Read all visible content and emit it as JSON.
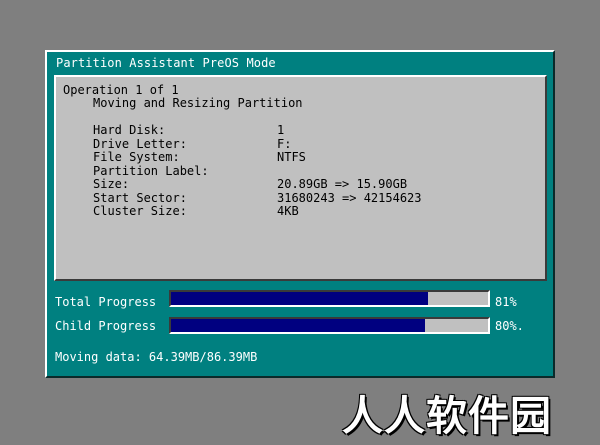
{
  "window": {
    "title": "Partition Assistant PreOS Mode"
  },
  "operation": {
    "header": "Operation 1 of 1",
    "task": "Moving and Resizing Partition",
    "details": [
      {
        "label": "Hard Disk:",
        "value": "1"
      },
      {
        "label": "Drive Letter:",
        "value": "F:"
      },
      {
        "label": "File System:",
        "value": "NTFS"
      },
      {
        "label": "Partition Label:",
        "value": ""
      },
      {
        "label": "Size:",
        "value": "20.89GB => 15.90GB"
      },
      {
        "label": "Start Sector:",
        "value": "31680243 => 42154623"
      },
      {
        "label": "Cluster Size:",
        "value": "4KB"
      }
    ]
  },
  "progress": {
    "total": {
      "label": "Total Progress",
      "percent_text": "81%",
      "fraction": 0.81
    },
    "child": {
      "label": "Child Progress",
      "percent_text": "80%.",
      "fraction": 0.8
    }
  },
  "status": {
    "moving_data": "Moving data: 64.39MB/86.39MB"
  },
  "colors": {
    "window_bg": "#008080",
    "bar_fill": "#000080",
    "panel_bg": "#c0c0c0",
    "desktop_bg": "#7f7f7f"
  },
  "watermark": "人人软件园"
}
